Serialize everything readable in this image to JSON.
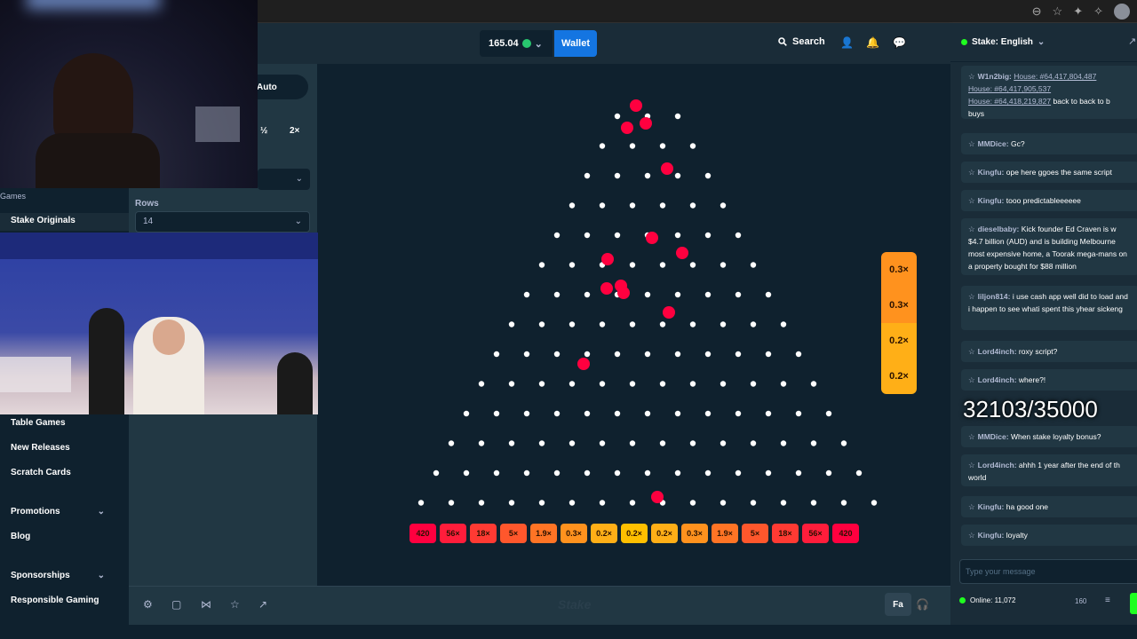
{
  "topbar": {
    "balance": "165.04",
    "wallet_label": "Wallet",
    "search_label": "Search"
  },
  "sidebar": {
    "games_label": "Games",
    "originals_label": "Stake Originals",
    "items": [
      {
        "label": "Table Games"
      },
      {
        "label": "New Releases"
      },
      {
        "label": "Scratch Cards"
      },
      {
        "label": "Promotions"
      },
      {
        "label": "Blog"
      },
      {
        "label": "Sponsorships"
      },
      {
        "label": "Responsible Gaming"
      }
    ]
  },
  "controls": {
    "auto_tab": "Auto",
    "half_label": "½",
    "double_label": "2×",
    "rows_label": "Rows",
    "rows_value": "14"
  },
  "plinko": {
    "rows": 14,
    "multipliers": [
      "420",
      "56×",
      "18×",
      "5×",
      "1.9×",
      "0.3×",
      "0.2×",
      "0.2×",
      "0.2×",
      "0.3×",
      "1.9×",
      "5×",
      "18×",
      "56×",
      "420"
    ],
    "bin_colors": [
      "#ff003f",
      "#ff1d3b",
      "#ff3a33",
      "#ff572c",
      "#ff7425",
      "#ff921e",
      "#ffaf17",
      "#ffc000",
      "#ffaf17",
      "#ff921e",
      "#ff7425",
      "#ff572c",
      "#ff3a33",
      "#ff1d3b",
      "#ff003f"
    ],
    "history": [
      {
        "label": "0.3×",
        "color": "#ff921e"
      },
      {
        "label": "0.3×",
        "color": "#ff921e"
      },
      {
        "label": "0.2×",
        "color": "#ffaf17"
      },
      {
        "label": "0.2×",
        "color": "#ffaf17"
      }
    ]
  },
  "footer": {
    "fairness_label": "Fa",
    "watermark": "Stake"
  },
  "chat": {
    "room_label": "Stake: English",
    "messages": [
      {
        "user": "W1n2big:",
        "text": "back to back to b",
        "links": [
          "House: #64,417,804,487",
          "House: #64,417,905,537",
          "House: #64,418,219,827"
        ],
        "tail": "buys"
      },
      {
        "user": "MMDice:",
        "text": "Gc?"
      },
      {
        "user": "Kingfu:",
        "text": "ope here ggoes the same script"
      },
      {
        "user": "Kingfu:",
        "text": "tooo predictableeeeee"
      },
      {
        "user": "dieselbaby:",
        "text": "Kick founder Ed Craven is w $4.7 billion (AUD) and is building Melbourne most expensive home, a Toorak mega-mans on a property bought for $88 million"
      },
      {
        "user": "liljon814:",
        "text": "i use cash app well did to load and i happen to see whati spent this yhear sickeng"
      },
      {
        "user": "Lord4inch:",
        "text": "roxy script?"
      },
      {
        "user": "Lord4inch:",
        "text": "where?!"
      },
      {
        "user": "MMDice:",
        "text": "When stake loyalty bonus?"
      },
      {
        "user": "Lord4inch:",
        "text": "ahhh 1 year after the end of th world"
      },
      {
        "user": "Kingfu:",
        "text": "ha good one"
      },
      {
        "user": "Kingfu:",
        "text": "loyalty"
      }
    ],
    "input_placeholder": "Type your message",
    "online_label": "Online: 11,072",
    "char_count": "160"
  },
  "overlay": {
    "counter": "32103/35000"
  }
}
